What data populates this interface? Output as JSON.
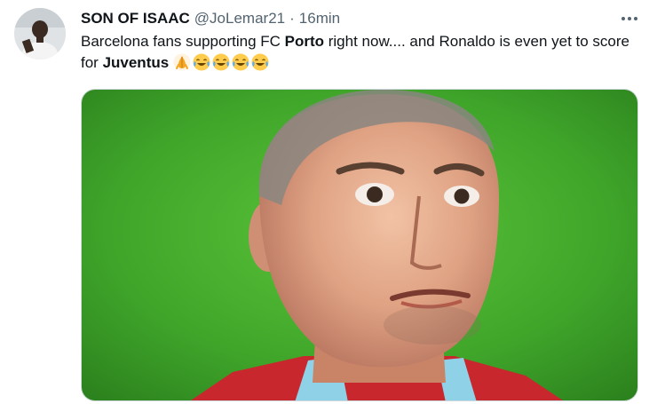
{
  "tweet": {
    "display_name": "SON OF ISAAC",
    "handle": "@JoLemar21",
    "separator": "·",
    "time": "16min",
    "text": {
      "part1": "Barcelona fans supporting FC ",
      "bold1": "Porto",
      "part2": " right now.... and Ronaldo is even yet to score for ",
      "bold2": "Juventus"
    },
    "emojis": [
      "praying-hands-emoji",
      "joy-emoji",
      "joy-emoji",
      "joy-emoji",
      "joy-emoji"
    ]
  },
  "icons": {
    "more": "more-horizontal-icon"
  },
  "colors": {
    "text_primary": "#0f1419",
    "text_secondary": "#536471",
    "media_background_green": "#3fa52a"
  }
}
